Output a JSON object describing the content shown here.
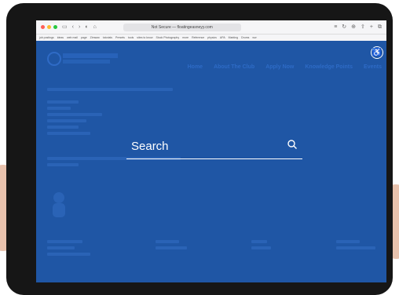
{
  "browser": {
    "address_text": "Not Secure — floatingeasneyy.com",
    "bookmarks": [
      "job postings",
      "ideas",
      "web mail",
      "page",
      "Zimsaw",
      "tutorials",
      "Presets",
      "tools",
      "sites to know",
      "Stock Photography",
      "more",
      "Reference",
      "physics",
      "APA",
      "Marking",
      "Drums",
      "ww"
    ]
  },
  "site": {
    "nav": [
      "Home",
      "About The Club",
      "Apply Now",
      "Knowledge Points",
      "Events"
    ],
    "search_label": "Search"
  },
  "colors": {
    "overlay": "#1f56a5",
    "tablet": "#161616",
    "text": "#ffffff"
  }
}
